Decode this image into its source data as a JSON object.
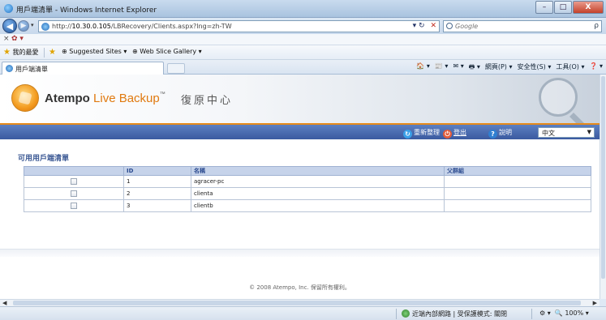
{
  "window": {
    "title": "用戶端清單 - Windows Internet Explorer",
    "buttons": {
      "minimize": "–",
      "maximize": "□",
      "close": "X"
    }
  },
  "nav": {
    "url_prefix": "http://",
    "url_host": "10.30.0.105",
    "url_path": "/LBRecovery/Clients.aspx?lng=zh-TW",
    "refresh_symbol": "↻",
    "stop_symbol": "✕",
    "search_placeholder": "Google",
    "search_go": "ρ"
  },
  "favorites": {
    "main": "我的最愛",
    "items": [
      "Suggested Sites ▾",
      "Web Slice Gallery ▾"
    ]
  },
  "tab": {
    "label": "用戶端清單"
  },
  "commandbar": {
    "items": [
      "🏠 ▾",
      "📰 ▾",
      "✉ ▾",
      "🖶 ▾",
      "網頁(P) ▾",
      "安全性(S) ▾",
      "工具(O) ▾",
      "❓ ▾"
    ]
  },
  "app": {
    "brand_primary": "Atempo",
    "brand_secondary": "Live Backup",
    "brand_tm": "™",
    "title": "復原中心",
    "toolbar": {
      "refresh": "重新整理",
      "logout": "登出",
      "help": "說明",
      "language": "中文"
    },
    "list_title": "可用用戶端清單",
    "table": {
      "headers": [
        "",
        "ID",
        "名稱",
        "父群組"
      ],
      "rows": [
        {
          "id": "1",
          "name": "agracer-pc",
          "group": ""
        },
        {
          "id": "2",
          "name": "clienta",
          "group": ""
        },
        {
          "id": "3",
          "name": "clientb",
          "group": ""
        }
      ]
    },
    "footer": "© 2008 Atempo, Inc. 保留所有權利。"
  },
  "statusbar": {
    "zone": "近端內部網路 | 受保護模式: 關閉",
    "zoom": "100%"
  },
  "colors": {
    "toolbar": "#3a5aa0",
    "accent_orange": "#e68a1a",
    "table_header": "#c6d3ea",
    "title_blue": "#3d5a95"
  }
}
